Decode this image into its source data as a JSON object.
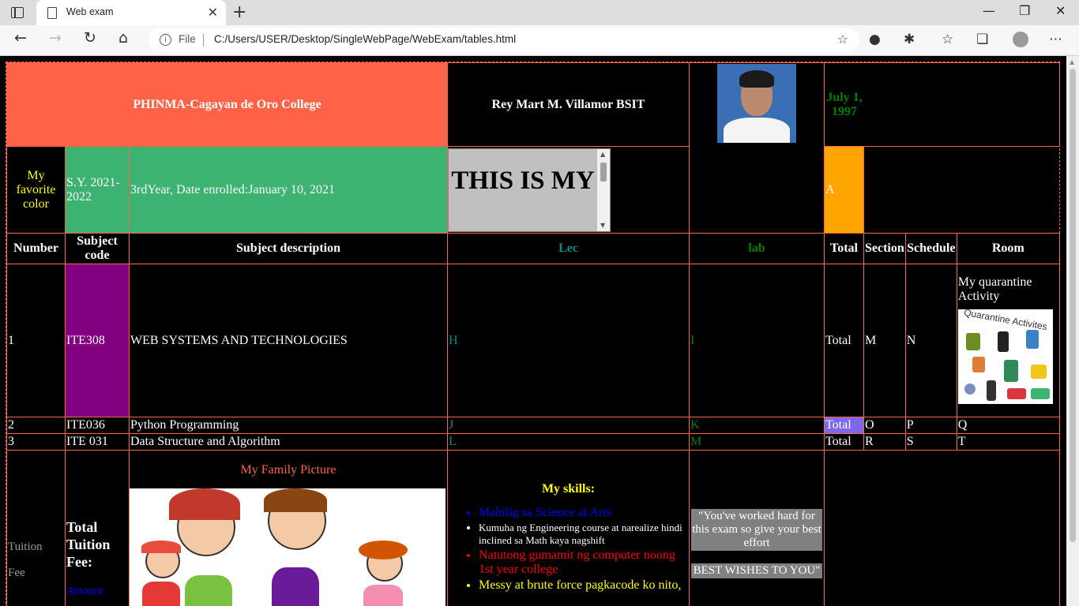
{
  "browser": {
    "tab_title": "Web exam",
    "address_prefix": "File",
    "url": "C:/Users/USER/Desktop/SingleWebPage/WebExam/tables.html"
  },
  "header": {
    "college": "PHINMA-Cagayan de Oro College",
    "student": "Rey Mart M. Villamor BSIT",
    "birthdate": "July 1, 1997",
    "favorite_color_label": "My favorite color",
    "school_year": "S.Y. 2021-2022",
    "year_enrolled": "3rdYear, Date enrolled:January 10, 2021",
    "marquee_text": "THIS IS MY",
    "grade_cell": "A"
  },
  "columns": [
    "Number",
    "Subject code",
    "Subject description",
    "Lec",
    "lab",
    "Total",
    "Section",
    "Schedule",
    "Room"
  ],
  "rows": [
    {
      "number": "1",
      "code": "ITE308",
      "desc": "WEB SYSTEMS AND TECHNOLOGIES",
      "lec": "H",
      "lab": "I",
      "total": "Total",
      "section": "M",
      "schedule": "N"
    },
    {
      "number": "2",
      "code": "ITE036",
      "desc": "Python Programming",
      "lec": "J",
      "lab": "K",
      "total": "Total",
      "section": "O",
      "schedule": "P",
      "room": "Q"
    },
    {
      "number": "3",
      "code": "ITE 031",
      "desc": "Data Structure and Algorithm",
      "lec": "L",
      "lab": "M",
      "total": "Total",
      "section": "R",
      "schedule": "S",
      "room": "T"
    }
  ],
  "quarantine": {
    "label": "My quarantine Activity",
    "image_text": "Quarantine Activites"
  },
  "footer": {
    "tuition_label_1": "Tuition",
    "tuition_label_2": "Fee",
    "total_tuition": "Total Tuition Fee:",
    "amount": "Amount",
    "family_caption": "My Family Picture",
    "skills_title": "My skills:",
    "skills": [
      {
        "text": "Mahilig sa Science at Arts",
        "color": "#0000ff"
      },
      {
        "text": "Kumuha ng Engineering course at narealize hindi inclined sa Math kaya nagshift",
        "color": "#ffffff"
      },
      {
        "text": "Natutong gumamit ng computer noong 1st year college",
        "color": "#ff0000"
      },
      {
        "text": "Messy at brute force pagkacode ko nito,",
        "color": "#ffff00"
      }
    ],
    "quote_1": "\"You've worked hard for this exam so give your best effort",
    "quote_2": "BEST WISHES TO YOU\""
  }
}
